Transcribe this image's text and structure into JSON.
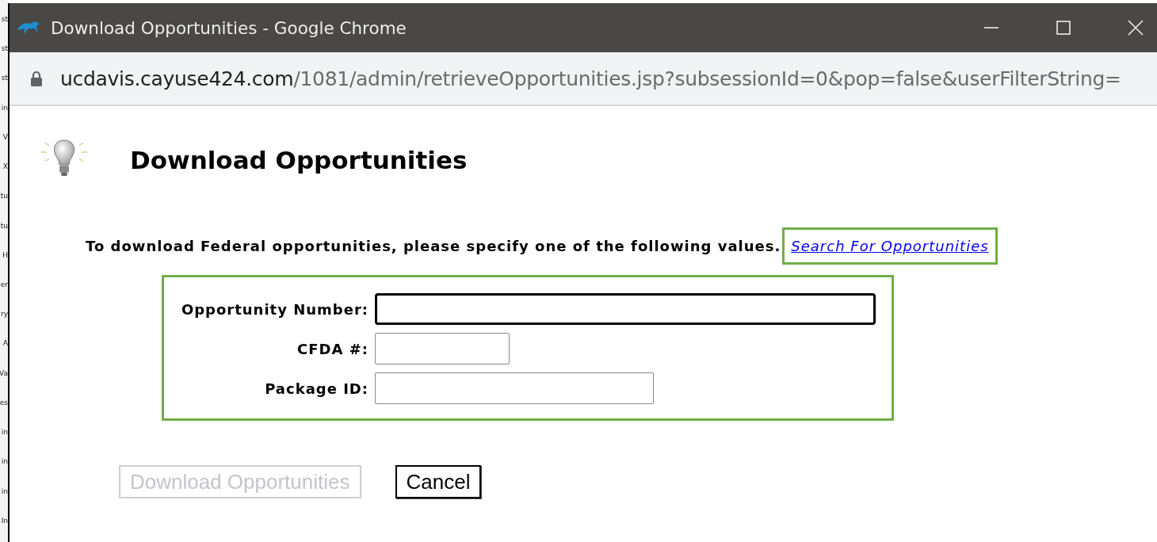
{
  "background_window": {
    "row_fragments": [
      "st",
      "st",
      "st",
      "in",
      "V",
      "X",
      "tu",
      "tu",
      "H",
      "er",
      "ry",
      "A",
      "Va",
      "es",
      "in",
      "in",
      "in",
      "In"
    ]
  },
  "window": {
    "title": "Download Opportunities - Google Chrome"
  },
  "address_bar": {
    "secure": true,
    "host": "ucdavis.cayuse424.com",
    "path": "/1081/admin/retrieveOpportunities.jsp?subsessionId=0&pop=false&userFilterString="
  },
  "page": {
    "heading": "Download Opportunities",
    "instruction": "To download Federal opportunities, please specify one of the following values.",
    "link": {
      "label": "Search For Opportunities",
      "highlighted": true
    },
    "form": {
      "highlighted": true,
      "fields": [
        {
          "label": "Opportunity Number:",
          "focused": true
        },
        {
          "label": "CFDA #:",
          "focused": false
        },
        {
          "label": "Package ID:",
          "focused": false
        }
      ]
    },
    "buttons": [
      {
        "label": "Download Opportunities",
        "disabled": true
      },
      {
        "label": "Cancel",
        "disabled": false
      }
    ]
  }
}
